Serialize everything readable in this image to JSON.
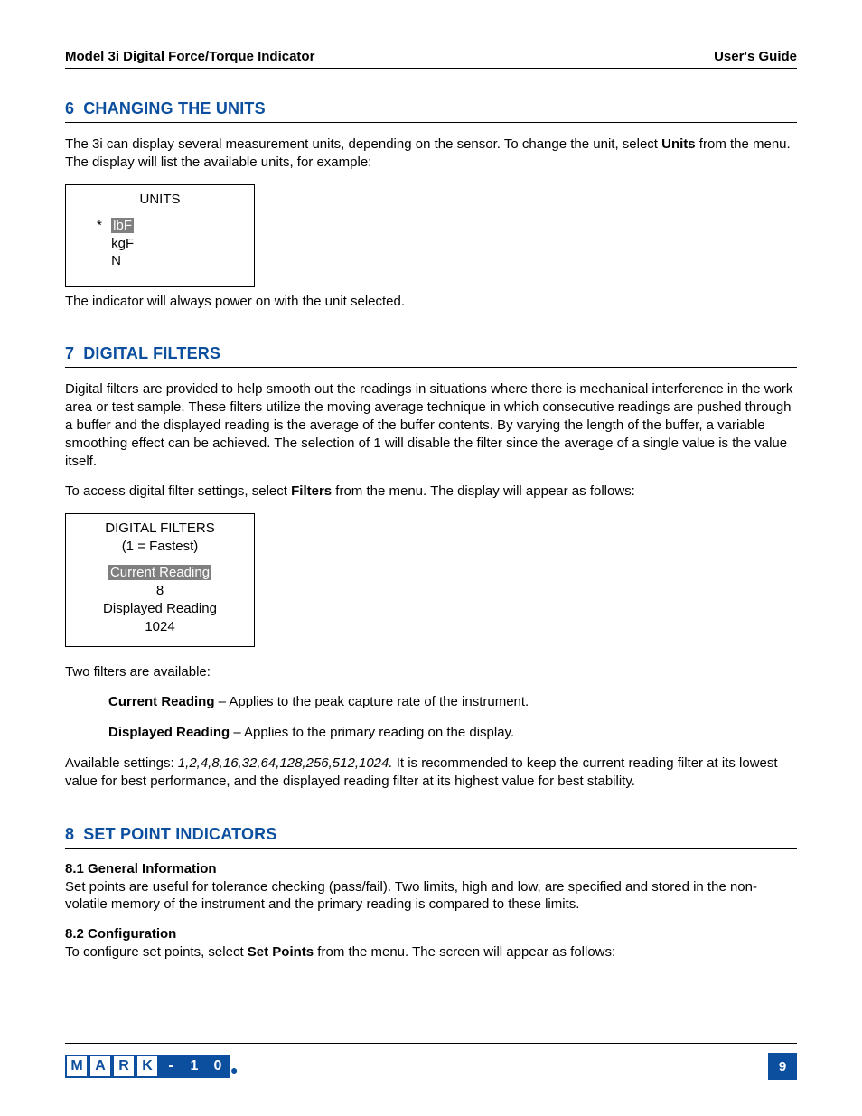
{
  "header": {
    "left": "Model 3i Digital Force/Torque Indicator",
    "right": "User's Guide"
  },
  "s6": {
    "num": "6",
    "title": "CHANGING THE UNITS",
    "p1a": "The 3i can display several measurement units, depending on the sensor. To change the unit, select ",
    "p1b": "Units",
    "p1c": " from the menu. The display will list the available units, for example:",
    "screen": {
      "title": "UNITS",
      "sel": "lbF",
      "opt2": "kgF",
      "opt3": "N"
    },
    "p2": "The indicator will always power on with the unit selected."
  },
  "s7": {
    "num": "7",
    "title": "DIGITAL FILTERS",
    "p1": "Digital filters are provided to help smooth out the readings in situations where there is mechanical interference in the work area or test sample. These filters utilize the moving average technique in which consecutive readings are pushed through a buffer and the displayed reading is the average of the buffer contents. By varying the length of the buffer, a variable smoothing effect can be achieved. The selection of 1 will disable the filter since the average of a single value is the value itself.",
    "p2a": "To access digital filter settings, select ",
    "p2b": "Filters",
    "p2c": " from the menu. The display will appear as follows:",
    "screen": {
      "l1": "DIGITAL FILTERS",
      "l2": "(1 = Fastest)",
      "l3": "Current Reading",
      "l4": "8",
      "l5": "Displayed Reading",
      "l6": "1024"
    },
    "p3": "Two filters are available:",
    "def1a": "Current Reading",
    "def1b": " – Applies to the peak capture rate of the instrument.",
    "def2a": "Displayed Reading",
    "def2b": " – Applies to the primary reading on the display.",
    "p4a": "Available settings: ",
    "p4b": "1,2,4,8,16,32,64,128,256,512,1024.",
    "p4c": " It is recommended to keep the current reading filter at its lowest value for best performance, and the displayed reading filter at its highest value for best stability."
  },
  "s8": {
    "num": "8",
    "title": "SET POINT INDICATORS",
    "h1": "8.1 General Information",
    "p1": "Set points are useful for tolerance checking (pass/fail). Two limits, high and low, are specified and stored in the non-volatile memory of the instrument and the primary reading is compared to these limits.",
    "h2": "8.2 Configuration",
    "p2a": "To configure set points, select ",
    "p2b": "Set Points",
    "p2c": " from the menu. The screen will appear as follows:"
  },
  "footer": {
    "logo": [
      "M",
      "A",
      "R",
      "K",
      "-",
      "1",
      "0"
    ],
    "page": "9"
  }
}
